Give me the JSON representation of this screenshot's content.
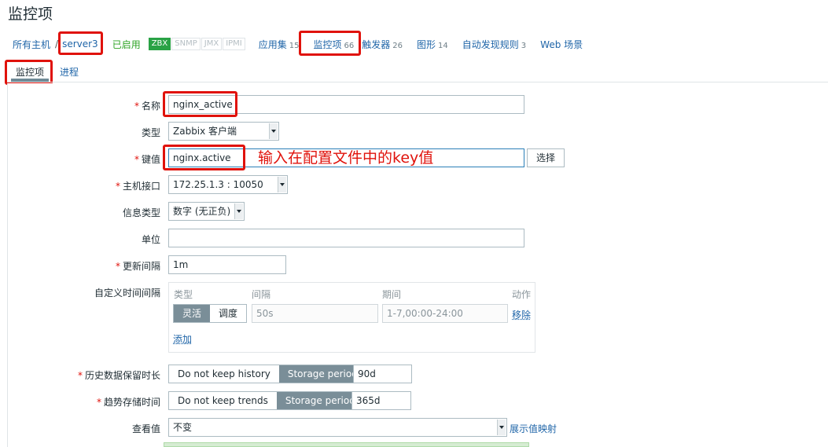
{
  "page": {
    "title": "监控项"
  },
  "hostnav": {
    "all_hosts": "所有主机",
    "separator": "/",
    "host": "server3",
    "status": "已启用",
    "badges": [
      "ZBX",
      "SNMP",
      "JMX",
      "IPMI"
    ],
    "items": [
      {
        "label": "应用集",
        "count": "15"
      },
      {
        "label": "监控项",
        "count": "66"
      },
      {
        "label": "触发器",
        "count": "26"
      },
      {
        "label": "图形",
        "count": "14"
      },
      {
        "label": "自动发现规则",
        "count": "3"
      },
      {
        "label": "Web 场景",
        "count": ""
      }
    ]
  },
  "tabs": {
    "active": "监控项",
    "other": "进程"
  },
  "form": {
    "name_label": "名称",
    "name_value": "nginx_active",
    "type_label": "类型",
    "type_value": "Zabbix 客户端",
    "key_label": "键值",
    "key_value": "nginx.active",
    "key_select_button": "选择",
    "annotation": "输入在配置文件中的key值",
    "iface_label": "主机接口",
    "iface_value": "172.25.1.3 : 10050",
    "info_type_label": "信息类型",
    "info_type_value": "数字 (无正负)",
    "unit_label": "单位",
    "unit_value": "",
    "interval_label": "更新间隔",
    "interval_value": "1m",
    "custom_label": "自定义时间间隔",
    "custom": {
      "col_type": "类型",
      "col_interval": "间隔",
      "col_period": "期间",
      "col_action": "动作",
      "flex": "灵活",
      "schedule": "调度",
      "interval_placeholder": "50s",
      "period_placeholder": "1-7,00:00-24:00",
      "remove": "移除",
      "add": "添加"
    },
    "history_label": "历史数据保留时长",
    "history_no_keep": "Do not keep history",
    "history_storage": "Storage period",
    "history_value": "90d",
    "trends_label": "趋势存储时间",
    "trends_no_keep": "Do not keep trends",
    "trends_storage": "Storage period",
    "trends_value": "365d",
    "valuemap_label": "查看值",
    "valuemap_value": "不变",
    "valuemap_link": "展示值映射"
  },
  "colors": {
    "highlight": "#e0120b",
    "link": "#1f65a8",
    "enabled": "#2ea324",
    "zbx_badge": "#29a245"
  }
}
